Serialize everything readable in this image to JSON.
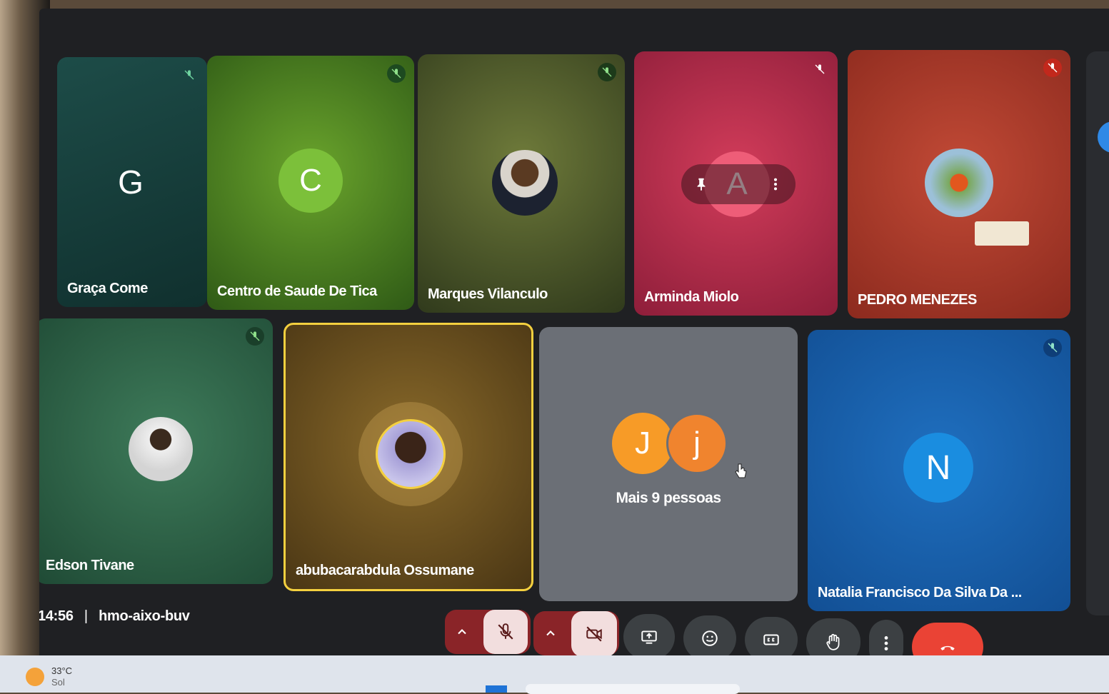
{
  "meeting": {
    "time": "14:56",
    "separator": "|",
    "code": "hmo-aixo-buv"
  },
  "participants": [
    {
      "name": "Graça Come",
      "avatar_letter": "G",
      "muted": true
    },
    {
      "name": "Centro de Saude De Tica",
      "avatar_letter": "C",
      "muted": true
    },
    {
      "name": "Marques Vilanculo",
      "avatar": "photo",
      "muted": true
    },
    {
      "name": "Arminda Miolo",
      "avatar_letter": "A",
      "muted": true
    },
    {
      "name": "PEDRO MENEZES",
      "avatar": "photo",
      "muted": true
    },
    {
      "name": "Edson Tivane",
      "avatar": "photo",
      "muted": true
    },
    {
      "name": "abubacarabdula Ossumane",
      "avatar": "photo",
      "speaking": true
    },
    {
      "name": "Natalia Francisco Da Silva Da ...",
      "avatar_letter": "N",
      "muted": true
    }
  ],
  "overflow_tile": {
    "avatars": [
      "J",
      "j"
    ],
    "label": "Mais 9 pessoas"
  },
  "controls": [
    "mic-options",
    "microphone-off",
    "camera-options",
    "camera-off",
    "present",
    "reactions",
    "captions",
    "raise-hand",
    "more-options",
    "leave-call"
  ],
  "taskbar": {
    "temperature": "33°C",
    "condition": "Sol"
  },
  "colors": {
    "leave": "#ea4335",
    "mic_off_red": "#a3282c",
    "speaking_border": "#f4d03f"
  }
}
